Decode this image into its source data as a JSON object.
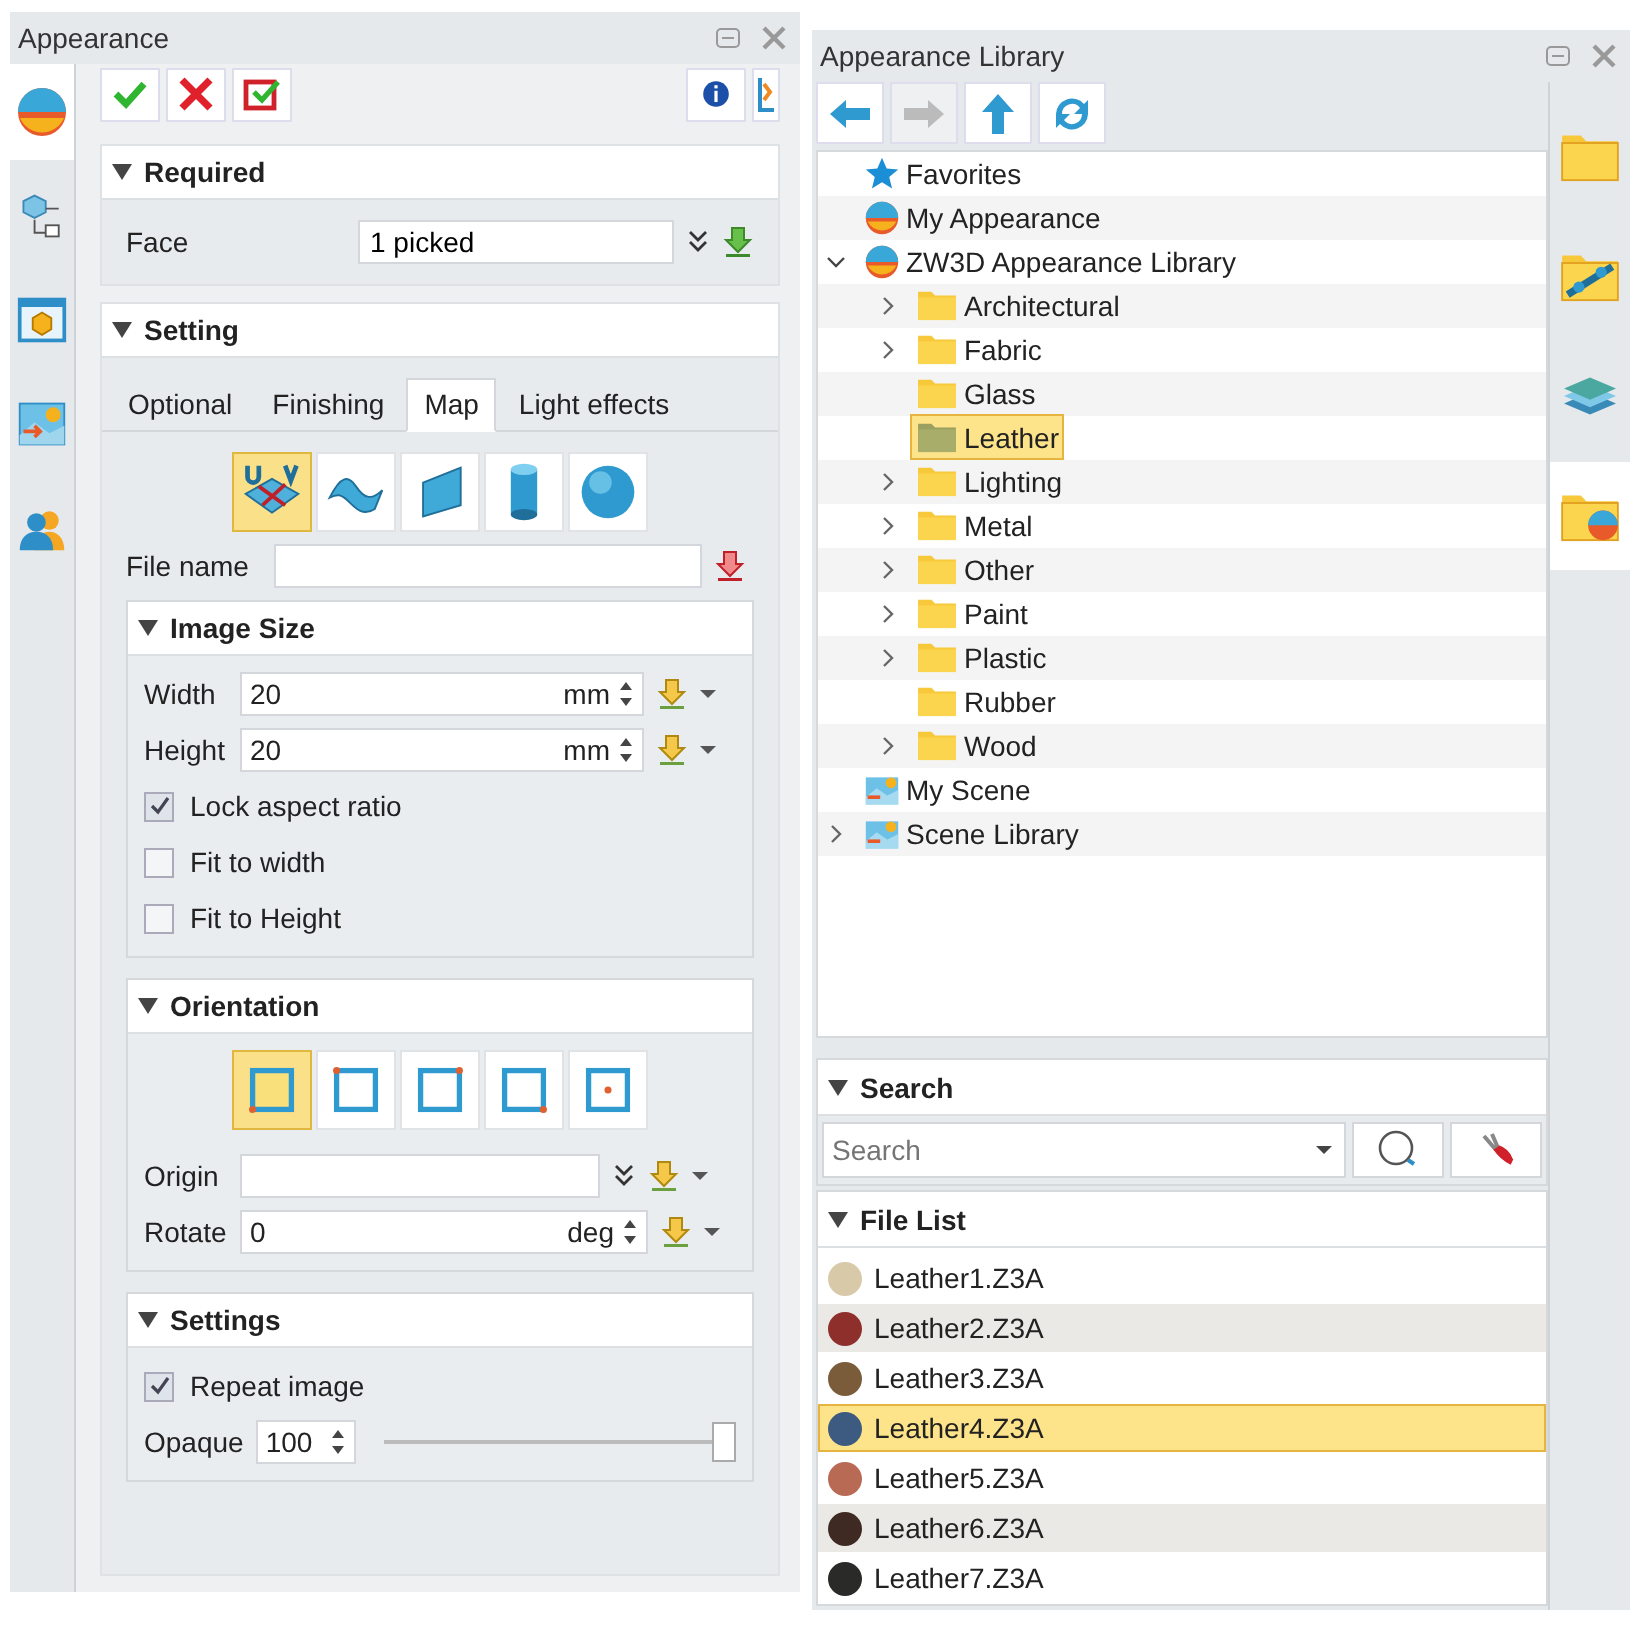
{
  "appearance": {
    "title": "Appearance",
    "side_tabs": [
      {
        "selected": true
      },
      {
        "selected": false
      },
      {
        "selected": false
      },
      {
        "selected": false
      },
      {
        "selected": false
      }
    ],
    "required": {
      "title": "Required",
      "expanded": true,
      "face": {
        "label": "Face",
        "value": "1 picked"
      }
    },
    "setting": {
      "title": "Setting",
      "expanded": true,
      "tabs": [
        {
          "label": "Optional",
          "selected": false
        },
        {
          "label": "Finishing",
          "selected": false
        },
        {
          "label": "Map",
          "selected": true
        },
        {
          "label": "Light effects",
          "selected": false
        }
      ],
      "map_types": [
        {
          "selected": true
        },
        {
          "selected": false
        },
        {
          "selected": false
        },
        {
          "selected": false
        },
        {
          "selected": false
        }
      ],
      "file_name": {
        "label": "File name"
      },
      "image_size": {
        "title": "Image Size",
        "expanded": true,
        "fields": [
          {
            "label": "Width",
            "value": "20",
            "unit": "mm"
          },
          {
            "label": "Height",
            "value": "20",
            "unit": "mm"
          }
        ],
        "options": [
          {
            "label": "Lock aspect ratio",
            "checked": true
          },
          {
            "label": "Fit to width",
            "checked": false
          },
          {
            "label": "Fit to Height",
            "checked": false
          }
        ]
      },
      "orientation": {
        "title": "Orientation",
        "expanded": true,
        "anchors": [
          {
            "selected": true
          },
          {
            "selected": false
          },
          {
            "selected": false
          },
          {
            "selected": false
          },
          {
            "selected": false
          }
        ],
        "origin": {
          "label": "Origin"
        },
        "rotate": {
          "label": "Rotate",
          "value": "0",
          "unit": "deg"
        }
      },
      "settings": {
        "title": "Settings",
        "expanded": true,
        "repeat": {
          "label": "Repeat image",
          "checked": true
        },
        "opaque": {
          "label": "Opaque",
          "value": "100",
          "level": 1
        }
      }
    }
  },
  "library": {
    "title": "Appearance Library",
    "nav": [
      {
        "disabled": false
      },
      {
        "disabled": true
      },
      {
        "disabled": false
      },
      {
        "disabled": false
      }
    ],
    "tree": [
      {
        "label": "Favorites",
        "kind": "star",
        "selected": false
      },
      {
        "label": "My Appearance",
        "kind": "sphere",
        "selected": false
      },
      {
        "label": "ZW3D Appearance Library",
        "kind": "sphere",
        "expanded": true,
        "selected": false,
        "children": [
          {
            "label": "Architectural",
            "kind": "folder",
            "expanded": false,
            "selected": false
          },
          {
            "label": "Fabric",
            "kind": "folder",
            "expanded": false,
            "selected": false
          },
          {
            "label": "Glass",
            "kind": "folder",
            "selected": false
          },
          {
            "label": "Leather",
            "kind": "folder",
            "selected": true
          },
          {
            "label": "Lighting",
            "kind": "folder",
            "expanded": false,
            "selected": false
          },
          {
            "label": "Metal",
            "kind": "folder",
            "expanded": false,
            "selected": false
          },
          {
            "label": "Other",
            "kind": "folder",
            "expanded": false,
            "selected": false
          },
          {
            "label": "Paint",
            "kind": "folder",
            "expanded": false,
            "selected": false
          },
          {
            "label": "Plastic",
            "kind": "folder",
            "expanded": false,
            "selected": false
          },
          {
            "label": "Rubber",
            "kind": "folder",
            "selected": false
          },
          {
            "label": "Wood",
            "kind": "folder",
            "expanded": false,
            "selected": false
          }
        ]
      },
      {
        "label": "My Scene",
        "kind": "scene",
        "selected": false
      },
      {
        "label": "Scene Library",
        "kind": "scene",
        "expanded": false,
        "selected": false
      }
    ],
    "side_tabs": [
      {
        "selected": false
      },
      {
        "selected": false
      },
      {
        "selected": false
      },
      {
        "selected": true
      }
    ],
    "search": {
      "title": "Search",
      "expanded": true,
      "placeholder": "Search"
    },
    "file_list": {
      "title": "File List",
      "expanded": true,
      "files": [
        {
          "name": "Leather1.Z3A",
          "color": "#d8c9a8",
          "selected": false
        },
        {
          "name": "Leather2.Z3A",
          "color": "#8e2f2c",
          "selected": false
        },
        {
          "name": "Leather3.Z3A",
          "color": "#7a5c3a",
          "selected": false
        },
        {
          "name": "Leather4.Z3A",
          "color": "#3d5a80",
          "selected": true
        },
        {
          "name": "Leather5.Z3A",
          "color": "#b86a55",
          "selected": false
        },
        {
          "name": "Leather6.Z3A",
          "color": "#3e2a22",
          "selected": false
        },
        {
          "name": "Leather7.Z3A",
          "color": "#2a2a28",
          "selected": false
        }
      ]
    }
  }
}
